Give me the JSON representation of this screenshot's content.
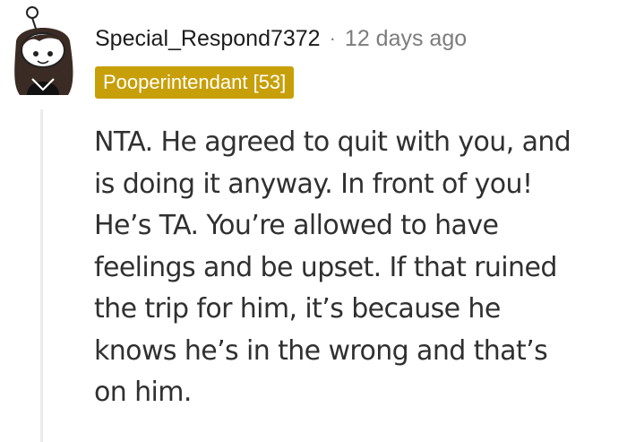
{
  "comment": {
    "username": "Special_Respond7372",
    "separator": "·",
    "timestamp": "12 days ago",
    "flair": "Pooperintendant [53]",
    "body_lines": [
      "NTA. He agreed to quit with you, and",
      "is doing it anyway. In front of you!",
      "He’s TA. You’re allowed to have",
      "feelings and be upset. If that ruined",
      "the trip for him, it’s because he",
      "knows he’s in the wrong and that’s",
      "on him."
    ]
  },
  "colors": {
    "flair_background": "#c79f09",
    "username": "#1c1c1c",
    "meta": "#7c7c7c",
    "body_text": "#303030",
    "thread_line": "#ececec"
  },
  "icons": {
    "avatar": "snoo-avatar-icon"
  }
}
